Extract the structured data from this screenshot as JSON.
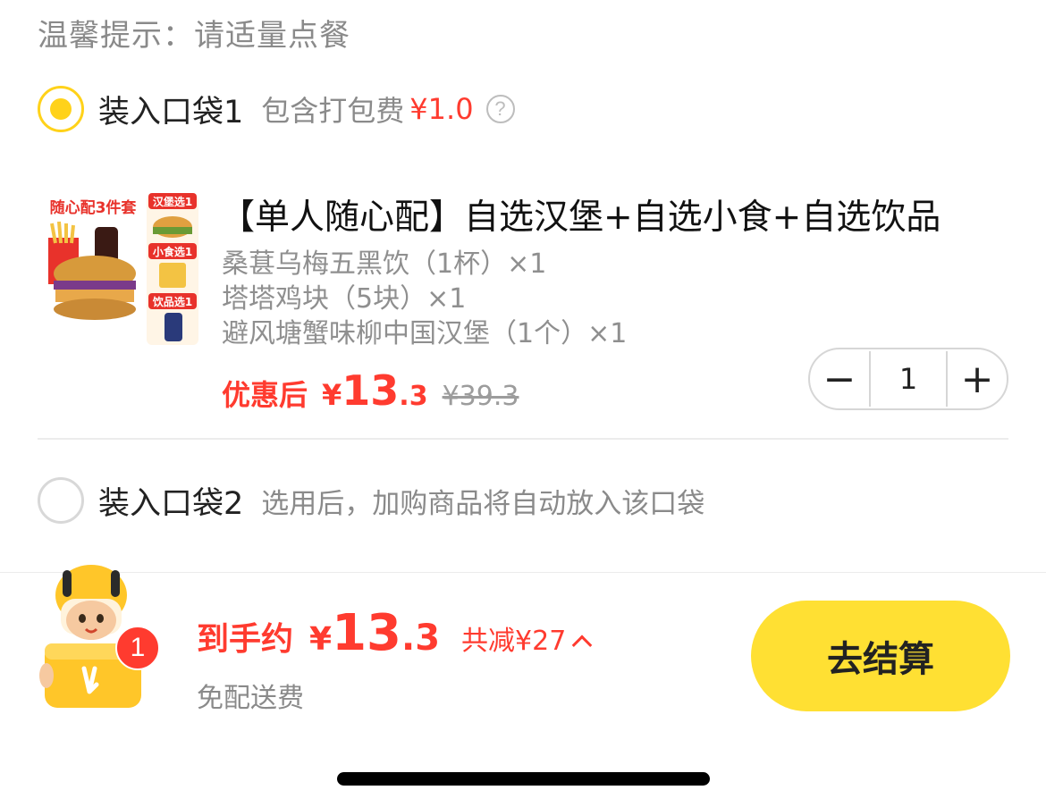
{
  "tip": "温馨提示：请适量点餐",
  "bag1": {
    "name": "装入口袋1",
    "sub": "包含打包费",
    "fee": "¥1.0",
    "help_icon": "?"
  },
  "product": {
    "image_badge": "随心配3件套",
    "image_tags": [
      "汉堡选1",
      "小食选1",
      "饮品选1"
    ],
    "title": "【单人随心配】自选汉堡+自选小食+自选饮品",
    "items": [
      "桑葚乌梅五黑饮（1杯）×1",
      "塔塔鸡块（5块）×1",
      "避风塘蟹味柳中国汉堡（1个）×1"
    ],
    "price_label": "优惠后",
    "price_yen": "¥",
    "price_int": "13",
    "price_dec": ".3",
    "price_original": "¥39.3",
    "quantity": "1",
    "minus": "−",
    "plus": "+"
  },
  "bag2": {
    "name": "装入口袋2",
    "sub": "选用后，加购商品将自动放入该口袋"
  },
  "footer": {
    "cart_count": "1",
    "total_label": "到手约",
    "total_yen": "¥",
    "total_int": "13",
    "total_dec": ".3",
    "saved": "共减¥27",
    "delivery": "免配送费",
    "checkout_label": "去结算"
  },
  "colors": {
    "accent_yellow": "#ffd21a",
    "price_red": "#ff3b2f",
    "checkout_yellow": "#ffe033"
  }
}
